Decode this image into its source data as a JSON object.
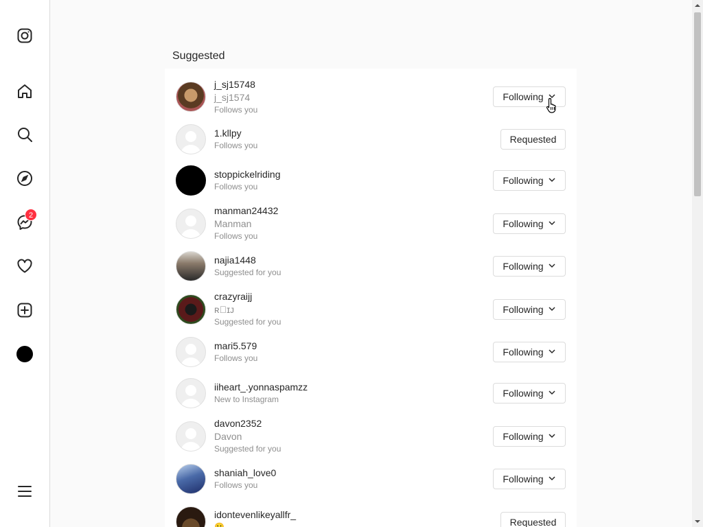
{
  "nav": {
    "items": [
      {
        "icon": "instagram-logo-icon"
      },
      {
        "icon": "home-icon"
      },
      {
        "icon": "search-icon"
      },
      {
        "icon": "explore-compass-icon"
      },
      {
        "icon": "messenger-icon",
        "badge": "2"
      },
      {
        "icon": "heart-icon"
      },
      {
        "icon": "create-plus-icon"
      },
      {
        "icon": "profile-avatar"
      },
      {
        "icon": "more-menu-icon"
      }
    ]
  },
  "main": {
    "section_title": "Suggested",
    "rows": [
      {
        "username": "j_sj15748",
        "fullname": "j_sj1574",
        "sub": "Follows you",
        "button": "Following",
        "avatar": "photo"
      },
      {
        "username": "1.kllpy",
        "fullname": "",
        "sub": "Follows you",
        "button": "Requested",
        "avatar": "placeholder"
      },
      {
        "username": "stoppickelriding",
        "fullname": "",
        "sub": "Follows you",
        "button": "Following",
        "avatar": "black"
      },
      {
        "username": "manman24432",
        "fullname": "Manman",
        "sub": "Follows you",
        "button": "Following",
        "avatar": "placeholder"
      },
      {
        "username": "najia1448",
        "fullname": "",
        "sub": "Suggested for you",
        "button": "Following",
        "avatar": "photo"
      },
      {
        "username": "crazyraijj",
        "fullname": "ʀ⃞ɪᴊ",
        "sub": "Suggested for you",
        "button": "Following",
        "avatar": "photo"
      },
      {
        "username": "mari5.579",
        "fullname": "",
        "sub": "Follows you",
        "button": "Following",
        "avatar": "placeholder"
      },
      {
        "username": "iiheart_.yonnaspamzz",
        "fullname": "",
        "sub": "New to Instagram",
        "button": "Following",
        "avatar": "placeholder"
      },
      {
        "username": "davon2352",
        "fullname": "Davon",
        "sub": "Suggested for you",
        "button": "Following",
        "avatar": "placeholder"
      },
      {
        "username": "shaniah_love0",
        "fullname": "",
        "sub": "Follows you",
        "button": "Following",
        "avatar": "photo"
      },
      {
        "username": "idontevenlikeyallfr_",
        "fullname": "",
        "sub": "🥲..",
        "button": "Requested",
        "avatar": "photo"
      }
    ]
  },
  "colors": {
    "badge": "#ff3040",
    "text_primary": "#262626",
    "text_secondary": "#8e8e8e",
    "border": "#dbdbdb"
  }
}
